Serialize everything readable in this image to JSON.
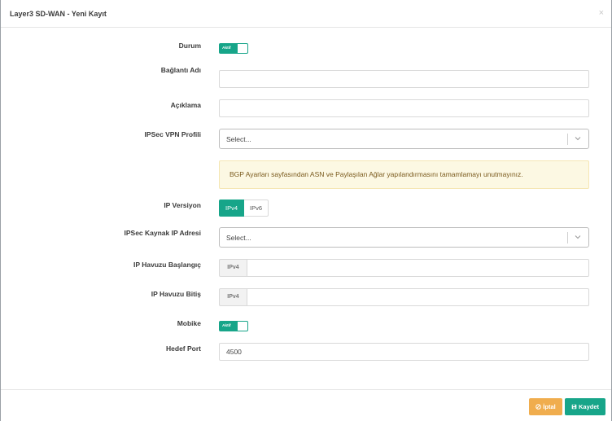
{
  "modal": {
    "title": "Layer3 SD-WAN - Yeni Kayıt",
    "close_label": "×"
  },
  "form": {
    "durum": {
      "label": "Durum",
      "toggle_text": "Aktif",
      "checked": true
    },
    "baglanti_adi": {
      "label": "Bağlantı Adı",
      "value": ""
    },
    "aciklama": {
      "label": "Açıklama",
      "value": ""
    },
    "ipsec_vpn_profili": {
      "label": "IPSec VPN Profili",
      "placeholder": "Select..."
    },
    "alert": {
      "text": "BGP Ayarları sayfasından ASN ve Paylaşılan Ağlar yapılandırmasını tamamlamayı unutmayınız."
    },
    "ip_versiyon": {
      "label": "IP Versiyon",
      "options": [
        "IPv4",
        "IPv6"
      ],
      "selected": "IPv4"
    },
    "ipsec_kaynak_ip": {
      "label": "IPSec Kaynak IP Adresi",
      "placeholder": "Select..."
    },
    "ip_havuzu_baslangic": {
      "label": "IP Havuzu Başlangıç",
      "addon": "IPv4",
      "value": ""
    },
    "ip_havuzu_bitis": {
      "label": "IP Havuzu Bitiş",
      "addon": "IPv4",
      "value": ""
    },
    "mobike": {
      "label": "Mobike",
      "toggle_text": "Aktif",
      "checked": true
    },
    "hedef_port": {
      "label": "Hedef Port",
      "value": "4500"
    }
  },
  "footer": {
    "cancel_label": "İptal",
    "save_label": "Kaydet"
  },
  "colors": {
    "primary": "#17a589",
    "warning": "#f0ad4e",
    "alert_bg": "#fcf8e3"
  }
}
